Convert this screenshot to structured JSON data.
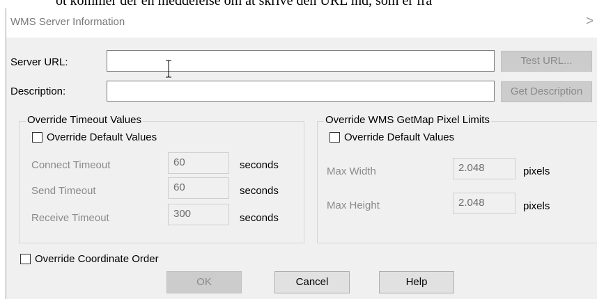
{
  "background_fragment": "ot kommer der en meddelelse om at skrive den URL ind, som er fra",
  "dialog": {
    "title": "WMS Server Information",
    "close_glyph": ">"
  },
  "server_url": {
    "label": "Server URL:",
    "value": "",
    "button": "Test URL..."
  },
  "description": {
    "label": "Description:",
    "value": "",
    "button": "Get Description"
  },
  "timeout_group": {
    "legend": "Override Timeout Values",
    "override_label": "Override Default Values",
    "override_checked": false,
    "rows": [
      {
        "label": "Connect Timeout",
        "value": "60",
        "unit": "seconds"
      },
      {
        "label": "Send Timeout",
        "value": "60",
        "unit": "seconds"
      },
      {
        "label": "Receive Timeout",
        "value": "300",
        "unit": "seconds"
      }
    ]
  },
  "pixel_group": {
    "legend": "Override WMS GetMap Pixel Limits",
    "override_label": "Override Default Values",
    "override_checked": false,
    "rows": [
      {
        "label": "Max Width",
        "value": "2.048",
        "unit": "pixels"
      },
      {
        "label": "Max Height",
        "value": "2.048",
        "unit": "pixels"
      }
    ]
  },
  "coordinate_order": {
    "label": "Override Coordinate Order",
    "checked": false
  },
  "buttons": {
    "ok": "OK",
    "cancel": "Cancel",
    "help": "Help"
  },
  "icons": {
    "cursor": "i-beam-cursor-icon"
  }
}
